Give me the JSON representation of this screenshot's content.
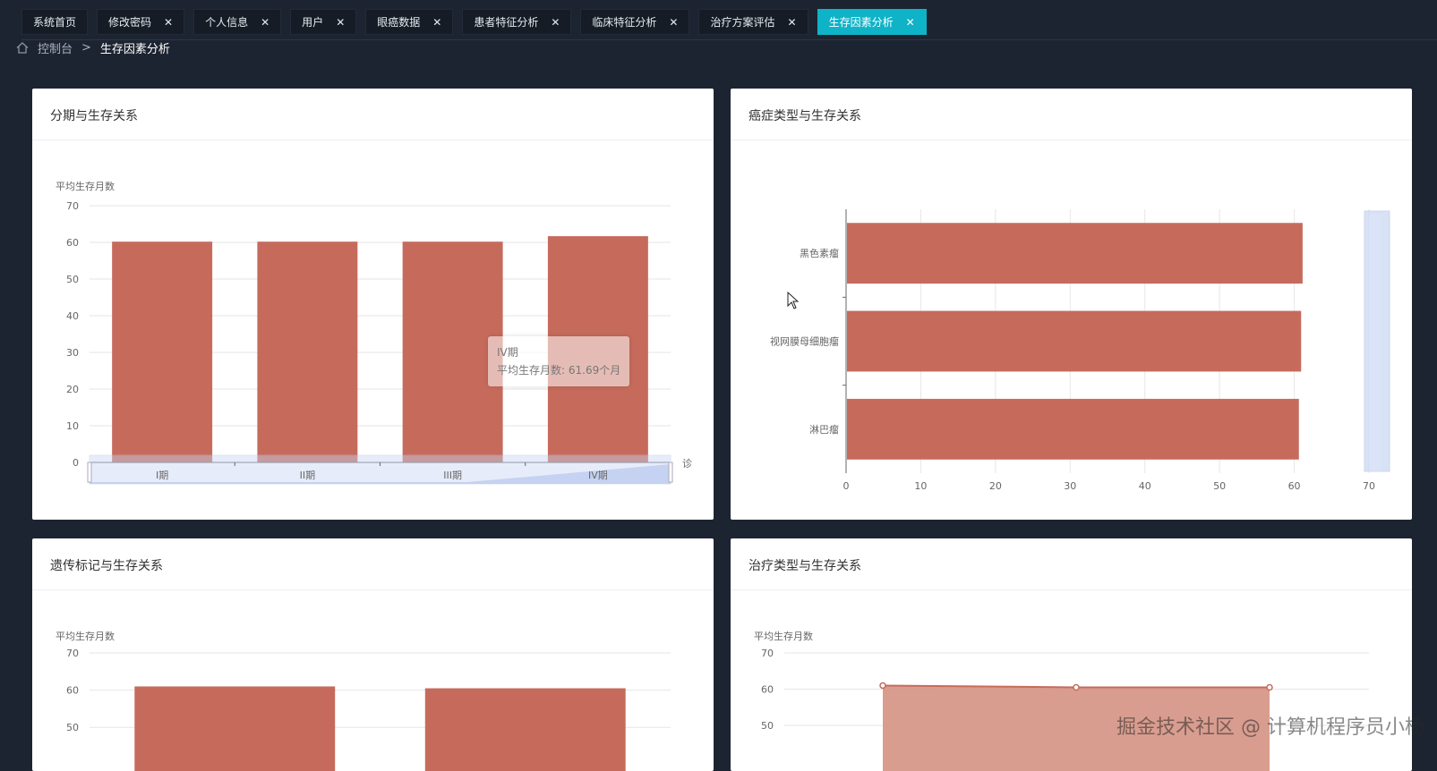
{
  "tabs": [
    {
      "label": "系统首页",
      "closable": false,
      "active": false
    },
    {
      "label": "修改密码",
      "closable": true,
      "active": false
    },
    {
      "label": "个人信息",
      "closable": true,
      "active": false
    },
    {
      "label": "用户",
      "closable": true,
      "active": false
    },
    {
      "label": "眼癌数据",
      "closable": true,
      "active": false
    },
    {
      "label": "患者特征分析",
      "closable": true,
      "active": false
    },
    {
      "label": "临床特征分析",
      "closable": true,
      "active": false
    },
    {
      "label": "治疗方案评估",
      "closable": true,
      "active": false
    },
    {
      "label": "生存因素分析",
      "closable": true,
      "active": true
    }
  ],
  "tab_close_glyph": "✕",
  "breadcrumb": {
    "home": "控制台",
    "separator": ">",
    "current": "生存因素分析"
  },
  "colors": {
    "bar": "#c66b5c",
    "bar_light": "#d59283",
    "accent": "#0fb3c8",
    "zoom": "#c8d6f2"
  },
  "cards": {
    "stage": {
      "title": "分期与生存关系"
    },
    "cancer": {
      "title": "癌症类型与生存关系"
    },
    "gene": {
      "title": "遗传标记与生存关系"
    },
    "treat": {
      "title": "治疗类型与生存关系"
    }
  },
  "chart_data": [
    {
      "type": "bar",
      "title": "分期与生存关系",
      "ylabel": "平均生存月数",
      "xlabel": "诊",
      "categories": [
        "I期",
        "II期",
        "III期",
        "IV期"
      ],
      "values": [
        60.2,
        60.2,
        60.2,
        61.69
      ],
      "ylim": [
        0,
        70
      ],
      "yticks": [
        0,
        10,
        20,
        30,
        40,
        50,
        60,
        70
      ],
      "grid": true,
      "datazoom": "bottom",
      "tooltip": {
        "category": "IV期",
        "label": "平均生存月数: 61.69个月"
      }
    },
    {
      "type": "bar",
      "orientation": "horizontal",
      "title": "癌症类型与生存关系",
      "categories": [
        "黑色素瘤",
        "视网膜母细胞瘤",
        "淋巴瘤"
      ],
      "values": [
        61,
        60.8,
        60.5
      ],
      "xlim": [
        0,
        70
      ],
      "xticks": [
        0,
        10,
        20,
        30,
        40,
        50,
        60,
        70
      ],
      "grid": true,
      "datazoom": "right"
    },
    {
      "type": "bar",
      "title": "遗传标记与生存关系",
      "ylabel": "平均生存月数",
      "values_visible": [
        61,
        60.5
      ],
      "yticks_visible": [
        50,
        60,
        70
      ],
      "grid": true
    },
    {
      "type": "area",
      "title": "治疗类型与生存关系",
      "ylabel": "平均生存月数",
      "values_visible": [
        61,
        60.5,
        60.5
      ],
      "yticks_visible": [
        50,
        60,
        70
      ],
      "grid": true
    }
  ],
  "watermark": "掘金技术社区 @ 计算机程序员小杨"
}
